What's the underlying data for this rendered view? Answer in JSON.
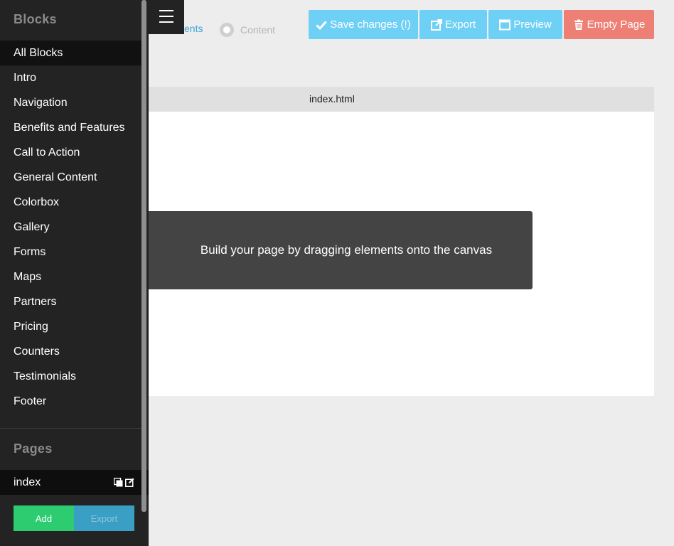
{
  "sidebar": {
    "blocks_title": "Blocks",
    "blocks": [
      {
        "label": "All Blocks"
      },
      {
        "label": "Intro"
      },
      {
        "label": "Navigation"
      },
      {
        "label": "Benefits and Features"
      },
      {
        "label": "Call to Action"
      },
      {
        "label": "General Content"
      },
      {
        "label": "Colorbox"
      },
      {
        "label": "Gallery"
      },
      {
        "label": "Forms"
      },
      {
        "label": "Maps"
      },
      {
        "label": "Partners"
      },
      {
        "label": "Pricing"
      },
      {
        "label": "Counters"
      },
      {
        "label": "Testimonials"
      },
      {
        "label": "Footer"
      }
    ],
    "active_block": "All Blocks",
    "pages_title": "Pages",
    "pages": [
      {
        "label": "index"
      }
    ],
    "add_label": "Add",
    "export_label": "Export"
  },
  "top_tabs": {
    "elements_label": "ents",
    "content_label": "Content"
  },
  "toolbar": {
    "save_label": "Save changes (!)",
    "export_label": "Export",
    "preview_label": "Preview",
    "empty_label": "Empty Page"
  },
  "canvas": {
    "title": "index.html",
    "hint": "Build your page by dragging elements onto the canvas"
  },
  "colors": {
    "sidebar_bg": "#232323",
    "accent_blue": "#6fd0f6",
    "danger": "#ee7f74",
    "add_green": "#2ecc71",
    "export_blue": "#3a9fc4",
    "tab_active": "#3fa3d8"
  },
  "icons": {
    "save": "check-icon",
    "export": "external-link-icon",
    "preview": "window-icon",
    "empty": "trash-icon",
    "page_copy": "duplicate-icon",
    "page_edit": "edit-icon",
    "menu": "hamburger-icon"
  }
}
